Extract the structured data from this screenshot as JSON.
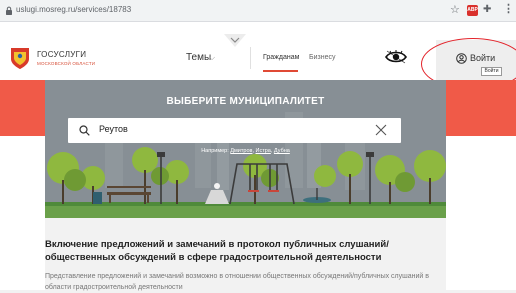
{
  "browser": {
    "url": "uslugi.mosreg.ru/services/18783",
    "extension_abp_label": "ABP",
    "icons": [
      "lock-icon",
      "star-icon",
      "puzzle-icon",
      "more-vert-icon"
    ]
  },
  "header": {
    "logo_title": "ГОСУСЛУГИ",
    "logo_subtitle": "МОСКОВСКОЙ ОБЛАСТИ",
    "nav_topics": "Темы",
    "nav_citizens": "Гражданам",
    "nav_business": "Бизнесу",
    "login_label": "Войти",
    "login_tooltip": "Войти"
  },
  "hero": {
    "title": "ВЫБЕРИТЕ МУНИЦИПАЛИТЕТ",
    "search_value": "Реутов",
    "hint_prefix": "Например:",
    "hint_links": [
      "Дмитров",
      "Истра",
      "Дубна"
    ]
  },
  "content": {
    "title": "Включение предложений и замечаний в протокол публичных слушаний/ общественных обсуждений в сфере градостроительной деятельности",
    "text": "Представление предложений и замечаний возможно в отношении общественных обсуждений/публичных слушаний в области градостроительной деятельности"
  },
  "colors": {
    "accent_red": "#f05a48",
    "hero_gray": "#889096",
    "annotation_red": "#e3242b"
  }
}
